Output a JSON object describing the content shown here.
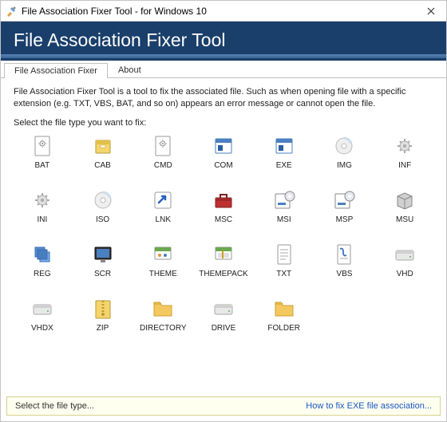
{
  "window": {
    "title": "File Association Fixer Tool - for Windows 10"
  },
  "header": {
    "title": "File Association Fixer Tool"
  },
  "tabs": [
    {
      "label": "File Association Fixer",
      "active": true
    },
    {
      "label": "About",
      "active": false
    }
  ],
  "intro": "File Association Fixer Tool is a tool to fix the associated file. Such as when opening file with a specific extension (e.g. TXT, VBS, BAT, and so on) appears an error message or cannot open the file.",
  "prompt": "Select the file type you want to fix:",
  "items": [
    {
      "label": "BAT",
      "icon": "gear-doc"
    },
    {
      "label": "CAB",
      "icon": "cab"
    },
    {
      "label": "CMD",
      "icon": "gear-doc"
    },
    {
      "label": "COM",
      "icon": "app-window"
    },
    {
      "label": "EXE",
      "icon": "app-window"
    },
    {
      "label": "IMG",
      "icon": "disc"
    },
    {
      "label": "INF",
      "icon": "gear"
    },
    {
      "label": "INI",
      "icon": "gear"
    },
    {
      "label": "ISO",
      "icon": "disc"
    },
    {
      "label": "LNK",
      "icon": "shortcut"
    },
    {
      "label": "MSC",
      "icon": "toolbox"
    },
    {
      "label": "MSI",
      "icon": "installer"
    },
    {
      "label": "MSP",
      "icon": "installer"
    },
    {
      "label": "MSU",
      "icon": "package"
    },
    {
      "label": "REG",
      "icon": "reg"
    },
    {
      "label": "SCR",
      "icon": "screen"
    },
    {
      "label": "THEME",
      "icon": "theme"
    },
    {
      "label": "THEMEPACK",
      "icon": "themepack"
    },
    {
      "label": "TXT",
      "icon": "txt"
    },
    {
      "label": "VBS",
      "icon": "script"
    },
    {
      "label": "VHD",
      "icon": "drive"
    },
    {
      "label": "VHDX",
      "icon": "drive"
    },
    {
      "label": "ZIP",
      "icon": "zip"
    },
    {
      "label": "DIRECTORY",
      "icon": "folder"
    },
    {
      "label": "DRIVE",
      "icon": "drive"
    },
    {
      "label": "FOLDER",
      "icon": "folder"
    }
  ],
  "statusbar": {
    "left": "Select the file type...",
    "link": "How to fix EXE file association..."
  }
}
